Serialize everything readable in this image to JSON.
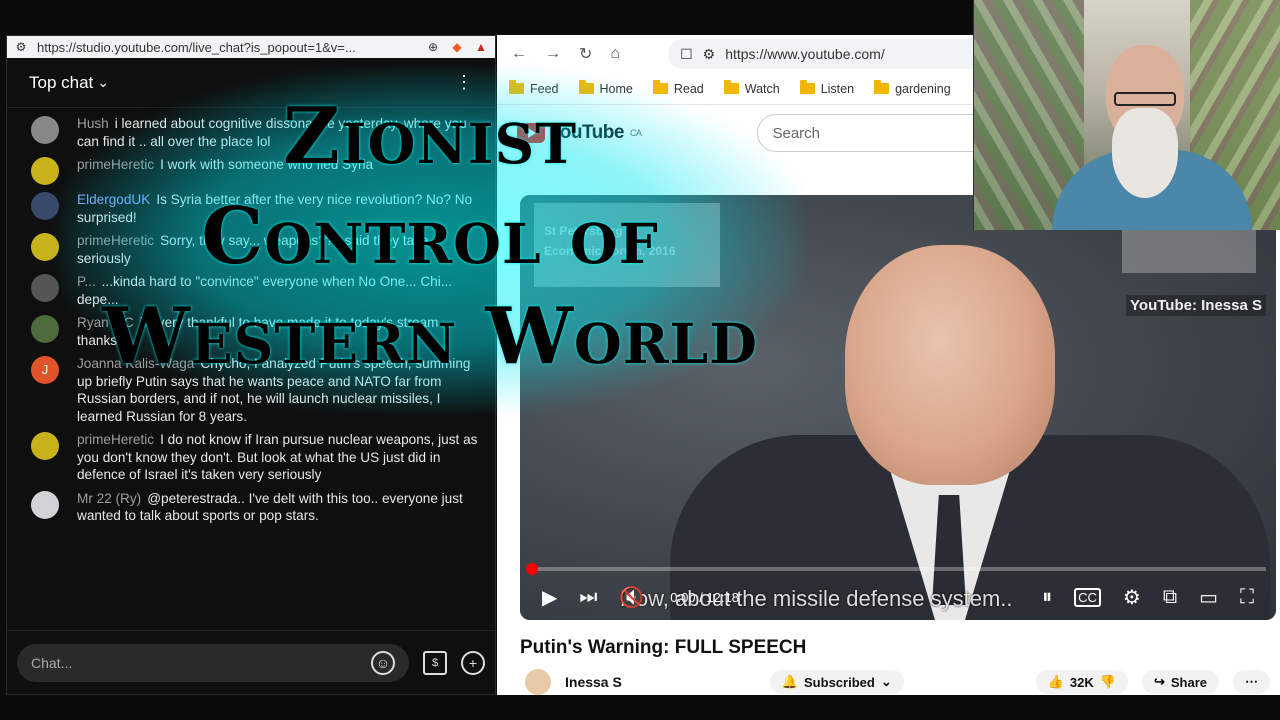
{
  "chat_window": {
    "url": "https://studio.youtube.com/live_chat?is_popout=1&v=...",
    "title": "Top chat",
    "input_placeholder": "Chat...",
    "messages": [
      {
        "author": "Hush",
        "text": "i learned about cognitive dissonance yesterday. where you can find it .. all over the place lol",
        "color": "#888888"
      },
      {
        "author": "primeHeretic",
        "text": "I work with someone who fled Syria",
        "color": "#c7b21a"
      },
      {
        "author": "EldergodUK",
        "text": "Is Syria better after the very nice revolution? No? No surprised!",
        "color": "#3a4a6b"
      },
      {
        "author": "primeHeretic",
        "text": "Sorry, they say... weapons?? I said they take... seriously",
        "color": "#c7b21a"
      },
      {
        "author": "P...",
        "text": "...kinda hard to \"convince\" everyone when No One... Chi... depe...",
        "color": "#555555"
      },
      {
        "author": "Ryan MC",
        "text": "im very thankful to have made it to today's stream thanks",
        "color": "#4d6b3c"
      },
      {
        "author": "Joanna Kalis-Waga",
        "text": "Chycho, I analyzed Putin's speech, summing up briefly Putin says that he wants peace and NATO far from Russian borders, and if not, he will launch nuclear missiles, I learned Russian for 8 years.",
        "color": "#e0542a",
        "initial": "J"
      },
      {
        "author": "primeHeretic",
        "text": "I do not know if Iran pursue nuclear weapons, just as you don't know they don't. But look at what the US just did in defence of Israel it's taken very seriously",
        "color": "#c7b21a"
      },
      {
        "author": "Mr 22 (Ry)",
        "text": "@peterestrada.. I've delt with this too.. everyone just wanted to talk about sports or pop stars.",
        "color": "#cfd3d8"
      }
    ]
  },
  "yt_window": {
    "url": "https://www.youtube.com/",
    "bookmarks": [
      "Feed",
      "Home",
      "Read",
      "Watch",
      "Listen",
      "gardening"
    ],
    "logo_text": "YouTube",
    "logo_region": "CA",
    "search_placeholder": "Search",
    "banner_lines": [
      "St Petersburg",
      "Economic Forum, 2016"
    ],
    "watermark_text": "YouTube: Inessa S",
    "time": "0:00 / 12:18",
    "progress_fraction": 0.0,
    "subtitle": "Now, about the missile defense system..",
    "video_title": "Putin's Warning: FULL SPEECH",
    "channel_name": "Inessa S",
    "subscribed_label": "Subscribed",
    "likes": "32K",
    "share_label": "Share"
  },
  "overlay": {
    "line1": "Zionist",
    "line2": "Control of",
    "line3": "Western World"
  }
}
